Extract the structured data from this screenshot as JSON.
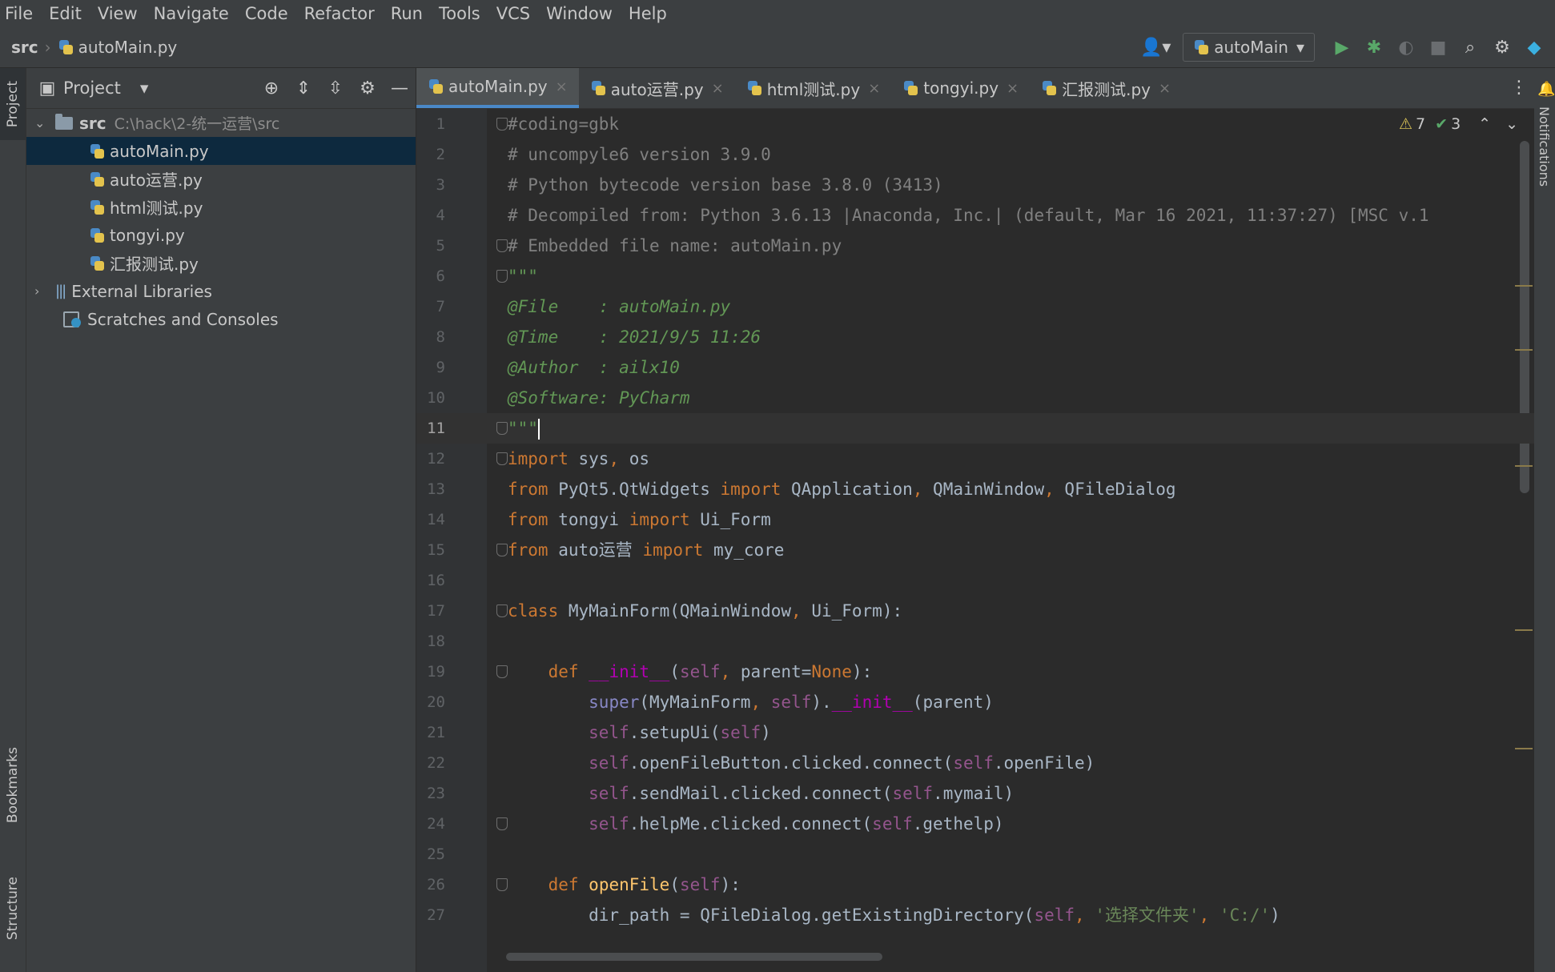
{
  "menu": [
    "File",
    "Edit",
    "View",
    "Navigate",
    "Code",
    "Refactor",
    "Run",
    "Tools",
    "VCS",
    "Window",
    "Help"
  ],
  "breadcrumb": {
    "root": "src",
    "file": "autoMain.py"
  },
  "run_config": {
    "name": "autoMain"
  },
  "side_tabs": {
    "project": "Project",
    "bookmarks": "Bookmarks",
    "structure": "Structure",
    "notifications": "Notifications"
  },
  "project_panel": {
    "title": "Project",
    "tree": {
      "root_name": "src",
      "root_path": "C:\\hack\\2-统一运营\\src",
      "files": [
        "autoMain.py",
        "auto运营.py",
        "html测试.py",
        "tongyi.py",
        "汇报测试.py"
      ],
      "external": "External Libraries",
      "scratches": "Scratches and Consoles"
    }
  },
  "editor_tabs": [
    "autoMain.py",
    "auto运营.py",
    "html测试.py",
    "tongyi.py",
    "汇报测试.py"
  ],
  "inspections": {
    "warnings": "7",
    "ok": "3"
  },
  "current_line": 11,
  "code_lines": [
    "#coding=gbk",
    "# uncompyle6 version 3.9.0",
    "# Python bytecode version base 3.8.0 (3413)",
    "# Decompiled from: Python 3.6.13 |Anaconda, Inc.| (default, Mar 16 2021, 11:37:27) [MSC v.1",
    "# Embedded file name: autoMain.py",
    "\"\"\"",
    "@File    : autoMain.py",
    "@Time    : 2021/9/5 11:26",
    "@Author  : ailx10",
    "@Software: PyCharm",
    "\"\"\"",
    "import sys, os",
    "from PyQt5.QtWidgets import QApplication, QMainWindow, QFileDialog",
    "from tongyi import Ui_Form",
    "from auto运营 import my_core",
    "",
    "class MyMainForm(QMainWindow, Ui_Form):",
    "",
    "    def __init__(self, parent=None):",
    "        super(MyMainForm, self).__init__(parent)",
    "        self.setupUi(self)",
    "        self.openFileButton.clicked.connect(self.openFile)",
    "        self.sendMail.clicked.connect(self.mymail)",
    "        self.helpMe.clicked.connect(self.gethelp)",
    "",
    "    def openFile(self):",
    "        dir_path = QFileDialog.getExistingDirectory(self, '选择文件夹', 'C:/')"
  ],
  "colors": {
    "keyword": "#cc7832",
    "self": "#94558d",
    "string": "#6a8759",
    "comment": "#808080",
    "docstring": "#629755",
    "function": "#ffc66d",
    "dunder": "#b200b2",
    "accent": "#4a88c7"
  }
}
